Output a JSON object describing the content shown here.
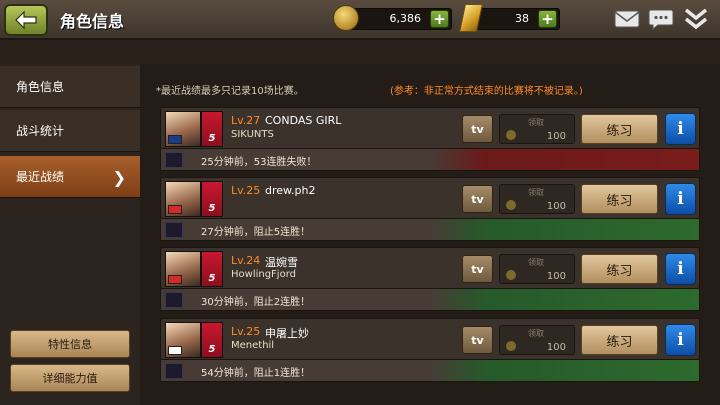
{
  "header": {
    "title": "角色信息",
    "coins": "6,386",
    "gold": "38"
  },
  "sidebar": {
    "items": [
      {
        "label": "角色信息"
      },
      {
        "label": "战斗统计"
      },
      {
        "label": "最近战绩"
      }
    ],
    "buttons": {
      "traits": "特性信息",
      "stats": "详细能力值"
    }
  },
  "main": {
    "note_left": "*最近战绩最多只记录10场比赛。",
    "note_right": "(参考：非正常方式结束的比赛将不被记录。)",
    "tv_label": "tv",
    "fetch_label": "领取",
    "practice_label": "练习",
    "info_label": "i",
    "records": [
      {
        "level": "Lv.27",
        "name": "CONDAS GIRL",
        "sub": "SIKUNTS",
        "result": "25分钟前，53连胜失败！",
        "amount": "100",
        "outcome": "loss",
        "flag_color": "#1c3b8c",
        "tier": "5"
      },
      {
        "level": "Lv.25",
        "name": "drew.ph2",
        "sub": "",
        "result": "27分钟前，阻止5连胜！",
        "amount": "100",
        "outcome": "win",
        "flag_color": "#d42a2a",
        "tier": "5"
      },
      {
        "level": "Lv.24",
        "name": "温婉雪",
        "sub": "HowlingFjord",
        "result": "30分钟前，阻止2连胜！",
        "amount": "100",
        "outcome": "win",
        "flag_color": "#d42a2a",
        "tier": "5"
      },
      {
        "level": "Lv.25",
        "name": "申屠上妙",
        "sub": "Menethil",
        "result": "54分钟前，阻止1连胜！",
        "amount": "100",
        "outcome": "win",
        "flag_color": "#ffffff",
        "tier": "5"
      }
    ]
  },
  "colors": {
    "accent_orange": "#ff8a26",
    "loss_red": "#7a1c1c",
    "win_green": "#2d6a2d",
    "active_tab": "#a85f2c"
  }
}
